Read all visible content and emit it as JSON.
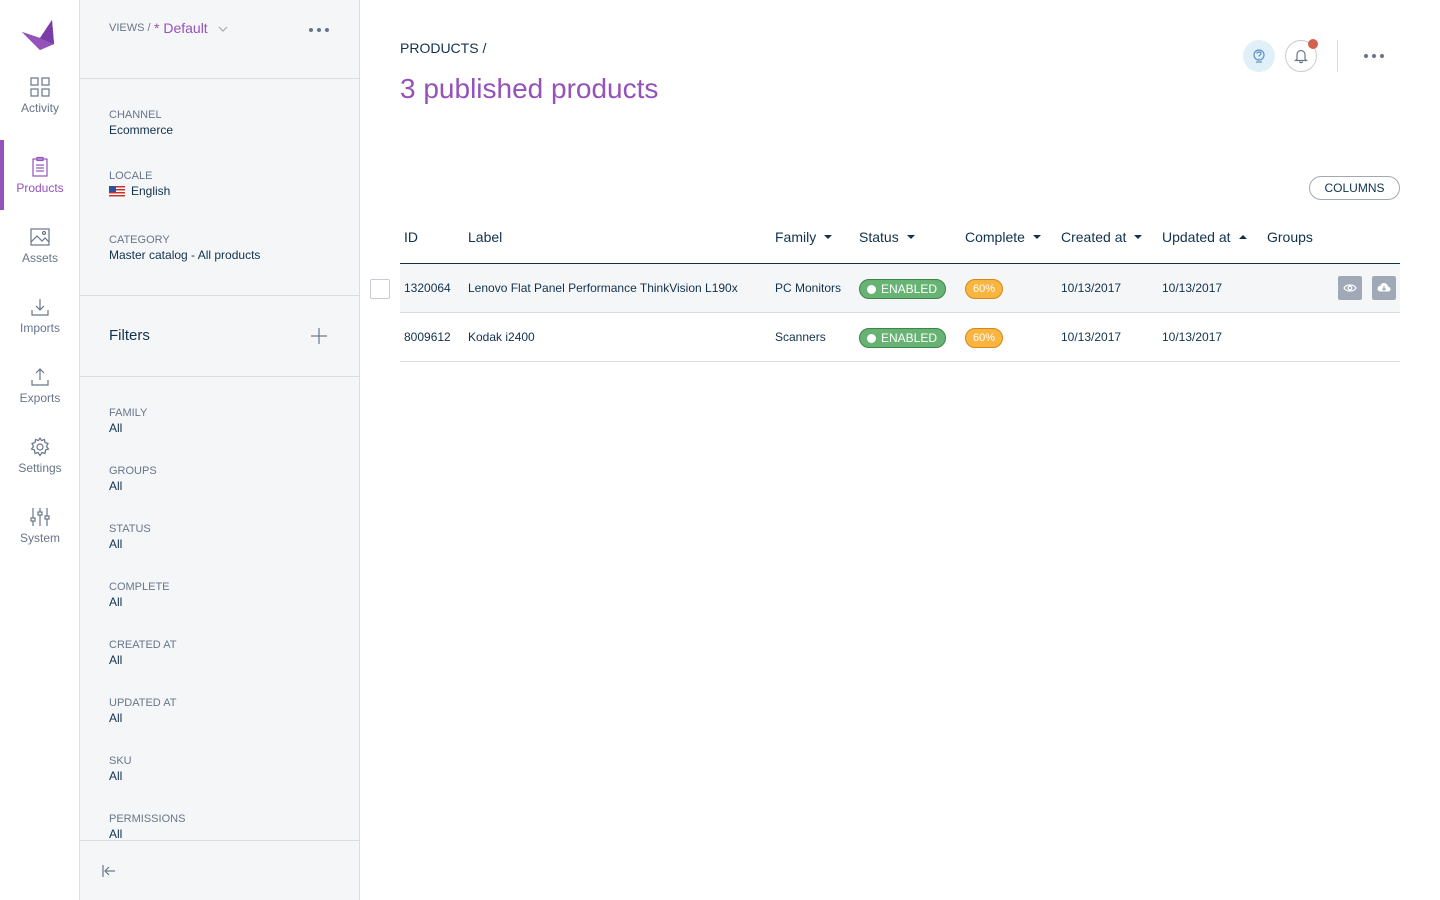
{
  "nav": {
    "items": [
      {
        "label": "Activity",
        "icon": "dashboard-icon",
        "active": false
      },
      {
        "label": "Products",
        "icon": "clipboard-icon",
        "active": true
      },
      {
        "label": "Assets",
        "icon": "image-icon",
        "active": false
      },
      {
        "label": "Imports",
        "icon": "import-icon",
        "active": false
      },
      {
        "label": "Exports",
        "icon": "export-icon",
        "active": false
      },
      {
        "label": "Settings",
        "icon": "gear-icon",
        "active": false
      },
      {
        "label": "System",
        "icon": "sliders-icon",
        "active": false
      }
    ]
  },
  "sidebar": {
    "views_label": "VIEWS /",
    "views_value": "* Default",
    "scopes": [
      {
        "label": "CHANNEL",
        "value": "Ecommerce"
      },
      {
        "label": "LOCALE",
        "value": "English"
      },
      {
        "label": "CATEGORY",
        "value": "Master catalog - All products"
      }
    ],
    "filters_title": "Filters",
    "filters": [
      {
        "label": "FAMILY",
        "value": "All"
      },
      {
        "label": "GROUPS",
        "value": "All"
      },
      {
        "label": "STATUS",
        "value": "All"
      },
      {
        "label": "COMPLETE",
        "value": "All"
      },
      {
        "label": "CREATED AT",
        "value": "All"
      },
      {
        "label": "UPDATED AT",
        "value": "All"
      },
      {
        "label": "SKU",
        "value": "All"
      },
      {
        "label": "PERMISSIONS",
        "value": "All"
      }
    ]
  },
  "header": {
    "breadcrumb": "PRODUCTS /",
    "title": "3 published products",
    "columns_button": "COLUMNS"
  },
  "table": {
    "headers": {
      "id": "ID",
      "label": "Label",
      "family": "Family",
      "status": "Status",
      "complete": "Complete",
      "created": "Created at",
      "updated": "Updated at",
      "groups": "Groups"
    },
    "rows": [
      {
        "id": "1320064",
        "label": "Lenovo Flat Panel Performance ThinkVision L190x",
        "family": "PC Monitors",
        "status": "ENABLED",
        "complete": "60%",
        "created": "10/13/2017",
        "updated": "10/13/2017"
      },
      {
        "id": "8009612",
        "label": "Kodak i2400",
        "family": "Scanners",
        "status": "ENABLED",
        "complete": "60%",
        "created": "10/13/2017",
        "updated": "10/13/2017"
      }
    ]
  },
  "colors": {
    "accent": "#9452ba",
    "enabled": "#67b373",
    "complete": "#f9b53f",
    "text": "#11324d"
  }
}
